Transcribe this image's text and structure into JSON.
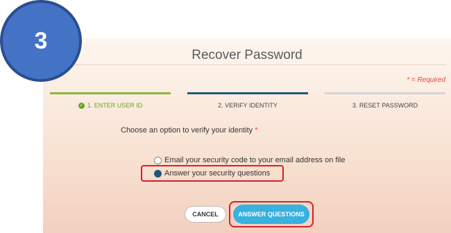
{
  "badge": {
    "number": "3"
  },
  "title": "Recover Password",
  "required_note": "* = Required",
  "steps": [
    {
      "label": "1. ENTER USER ID",
      "color": "#6aa121",
      "state": "completed"
    },
    {
      "label": "2. VERIFY IDENTITY",
      "color": "#1f5a78",
      "state": "current"
    },
    {
      "label": "3. RESET PASSWORD",
      "color": "#d6d6d6",
      "state": "upcoming"
    }
  ],
  "prompt": {
    "text": "Choose an option to verify your identity",
    "required_mark": "*"
  },
  "options": [
    {
      "label": "Email your security code to your email address on file",
      "selected": false
    },
    {
      "label": "Answer your security questions",
      "selected": true
    }
  ],
  "buttons": {
    "cancel": "CANCEL",
    "submit": "ANSWER QUESTIONS"
  },
  "colors": {
    "accent": "#37b1e0",
    "highlight": "#d42027",
    "selected_radio": "#1b5a7a"
  }
}
